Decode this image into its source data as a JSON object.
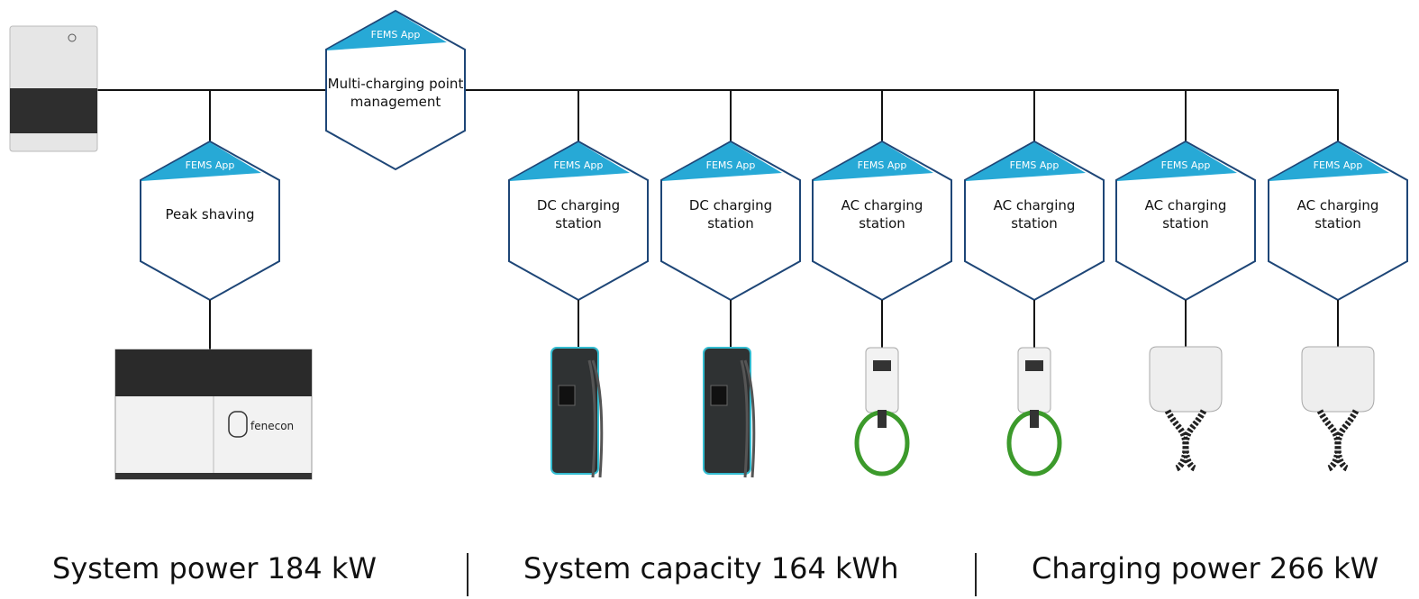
{
  "colors": {
    "hex_border": "#1e4677",
    "banner": "#27a9d6",
    "line": "#111111"
  },
  "hub": {
    "app_label": "FEMS App",
    "label_lines": [
      "Multi-charging point",
      "management"
    ]
  },
  "nodes": [
    {
      "app_label": "FEMS App",
      "label_lines": [
        "Peak shaving"
      ],
      "device": "battery-storage"
    },
    {
      "app_label": "FEMS App",
      "label_lines": [
        "DC charging",
        "station"
      ],
      "device": "dc-charger"
    },
    {
      "app_label": "FEMS App",
      "label_lines": [
        "DC charging",
        "station"
      ],
      "device": "dc-charger"
    },
    {
      "app_label": "FEMS App",
      "label_lines": [
        "AC charging",
        "station"
      ],
      "device": "ac-wallbox"
    },
    {
      "app_label": "FEMS App",
      "label_lines": [
        "AC charging",
        "station"
      ],
      "device": "ac-wallbox"
    },
    {
      "app_label": "FEMS App",
      "label_lines": [
        "AC charging",
        "station"
      ],
      "device": "ac-dual-wallbox"
    },
    {
      "app_label": "FEMS App",
      "label_lines": [
        "AC charging",
        "station"
      ],
      "device": "ac-dual-wallbox"
    }
  ],
  "battery_brand": "fenecon",
  "footer": {
    "power": "System power 184 kW",
    "capacity": "System capacity 164 kWh",
    "charging": "Charging power 266 kW"
  }
}
